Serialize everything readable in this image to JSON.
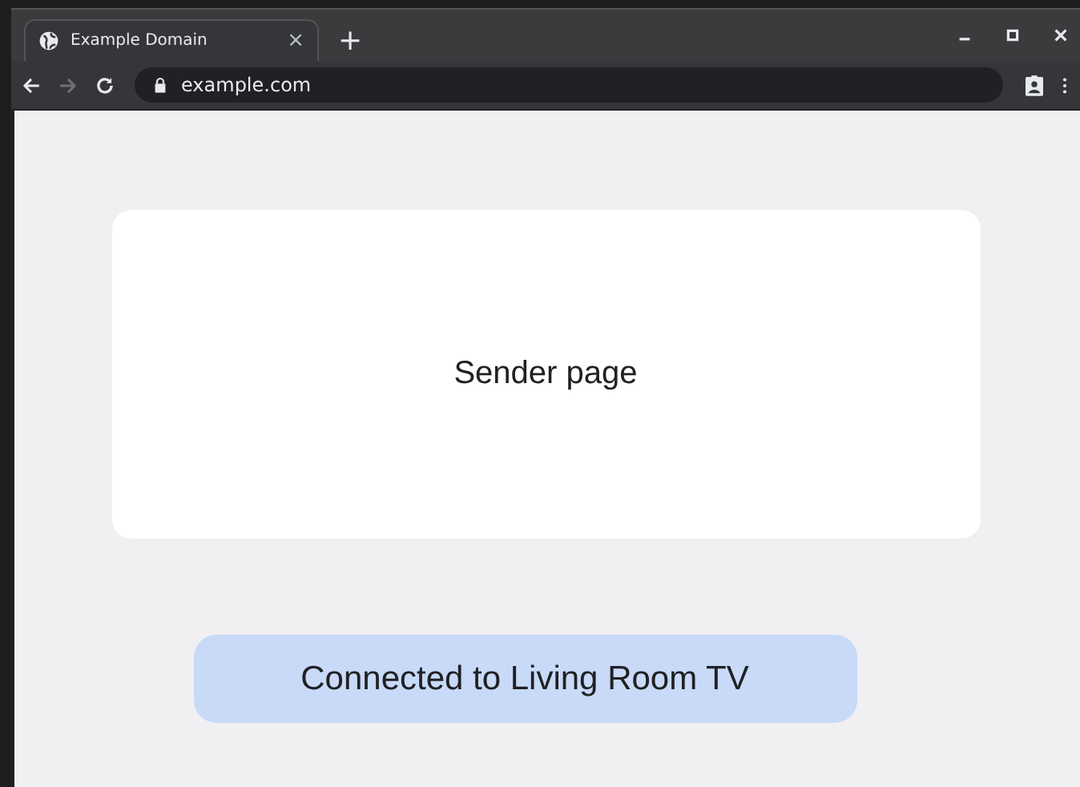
{
  "tabs": [
    {
      "title": "Example Domain",
      "close": "×",
      "selected": true
    }
  ],
  "new_tab": "+",
  "toolbar": {
    "back_disabled": false,
    "forward_disabled": true,
    "url": "example.com"
  },
  "page": {
    "card_text": "Sender page",
    "status": "Connected to Living Room TV"
  }
}
